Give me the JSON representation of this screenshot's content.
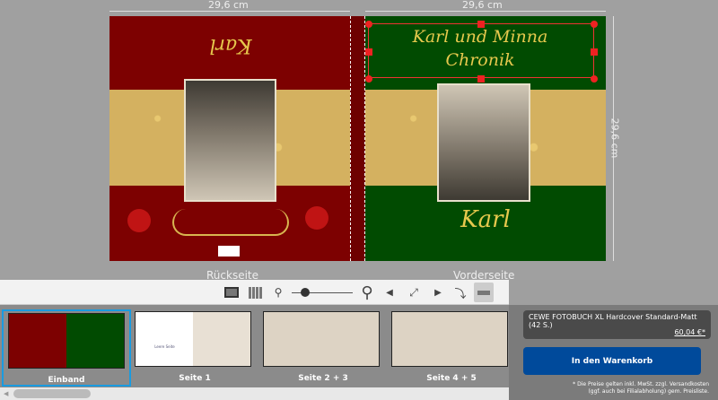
{
  "ruler": {
    "width_label_back": "29,6 cm",
    "width_label_front": "29,6 cm",
    "height_label": "29,6 cm"
  },
  "cover": {
    "back_title": "Karl",
    "front_title_line1": "Karl und Minna",
    "front_title_line2": "Chronik",
    "front_name": "Karl"
  },
  "labels": {
    "back": "Rückseite",
    "front": "Vorderseite"
  },
  "toolbar": {
    "icons": [
      "single-page-view-icon",
      "grid-view-icon",
      "zoom-out-icon",
      "zoom-slider",
      "zoom-in-icon",
      "prev-page-icon",
      "fullscreen-icon",
      "next-page-icon",
      "swap-pages-icon",
      "ruler-toggle-icon"
    ],
    "zoom_level": 0.15
  },
  "thumbnails": [
    {
      "label": "Einband",
      "selected": true
    },
    {
      "label": "Seite 1",
      "empty_text": "Leere Seite"
    },
    {
      "label": "Seite 2 + 3"
    },
    {
      "label": "Seite 4 + 5"
    }
  ],
  "panel": {
    "product": "CEWE FOTOBUCH XL Hardcover Standard-Matt (42 S.)",
    "price": "60,04 €*",
    "cart_button": "In den Warenkorb",
    "note_line1": "* Die Preise gelten inkl. MwSt. zzgl. Versandkosten",
    "note_line2": "(ggf. auch bei Filialabholung) gem. Preisliste."
  },
  "colors": {
    "back": "#7d0101",
    "front": "#014b01",
    "gold": "#d4b160",
    "cart": "#004a9b",
    "selected": "#1a9be0"
  }
}
